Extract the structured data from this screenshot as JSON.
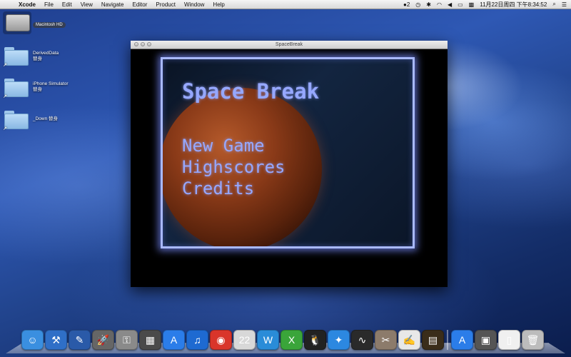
{
  "menubar": {
    "apple": "",
    "app_name": "Xcode",
    "menus": [
      "File",
      "Edit",
      "View",
      "Navigate",
      "Editor",
      "Product",
      "Window",
      "Help"
    ],
    "status_badge": "2",
    "clock": "11月22日周四 下午8:34:52"
  },
  "desktop": {
    "hd_label": "Macintosh HD",
    "folders": [
      {
        "label": "DerivedData 替身"
      },
      {
        "label": "iPhone Simulator 替身"
      },
      {
        "label": "_Down 替身"
      }
    ]
  },
  "window": {
    "title": "SpaceBreak",
    "game": {
      "title": "Space Break",
      "menu": [
        "New Game",
        "Highscores",
        "Credits"
      ]
    }
  },
  "dock": {
    "icons": [
      {
        "name": "finder-icon",
        "glyph": "☺",
        "color": "#3a8fe0"
      },
      {
        "name": "xcode-icon",
        "glyph": "⚒",
        "color": "#2f6fc7"
      },
      {
        "name": "instruments-icon",
        "glyph": "✎",
        "color": "#2a5aa8"
      },
      {
        "name": "launchpad-icon",
        "glyph": "🚀",
        "color": "#666666"
      },
      {
        "name": "keychain-icon",
        "glyph": "⚿",
        "color": "#8a8a8a"
      },
      {
        "name": "dashboard-icon",
        "glyph": "▦",
        "color": "#4a4a4a"
      },
      {
        "name": "appstore-icon",
        "glyph": "A",
        "color": "#2b7de9"
      },
      {
        "name": "itunes-icon",
        "glyph": "♫",
        "color": "#1e6ad1"
      },
      {
        "name": "chrome-icon",
        "glyph": "◉",
        "color": "#d9352a"
      },
      {
        "name": "calendar-icon",
        "glyph": "22",
        "color": "#d8d8d8"
      },
      {
        "name": "wps-writer-icon",
        "glyph": "W",
        "color": "#2a8cd8"
      },
      {
        "name": "wps-spreadsheet-icon",
        "glyph": "X",
        "color": "#3aa53a"
      },
      {
        "name": "qq-icon",
        "glyph": "🐧",
        "color": "#222222"
      },
      {
        "name": "safari-icon",
        "glyph": "✦",
        "color": "#2c88e0"
      },
      {
        "name": "activity-monitor-icon",
        "glyph": "∿",
        "color": "#2a2a2a"
      },
      {
        "name": "utilities-icon",
        "glyph": "✂",
        "color": "#8c7b6b"
      },
      {
        "name": "textedit-icon",
        "glyph": "✍",
        "color": "#e8e8e8"
      },
      {
        "name": "game-icon",
        "glyph": "▤",
        "color": "#3a2d1a"
      }
    ],
    "right_icons": [
      {
        "name": "downloads-stack-icon",
        "glyph": "A",
        "color": "#2b7de9"
      },
      {
        "name": "documents-stack-icon",
        "glyph": "▣",
        "color": "#555555"
      },
      {
        "name": "file-icon",
        "glyph": "▯",
        "color": "#f0f0f0"
      },
      {
        "name": "trash-icon",
        "glyph": "🗑",
        "color": "#bcbcbc"
      }
    ]
  }
}
